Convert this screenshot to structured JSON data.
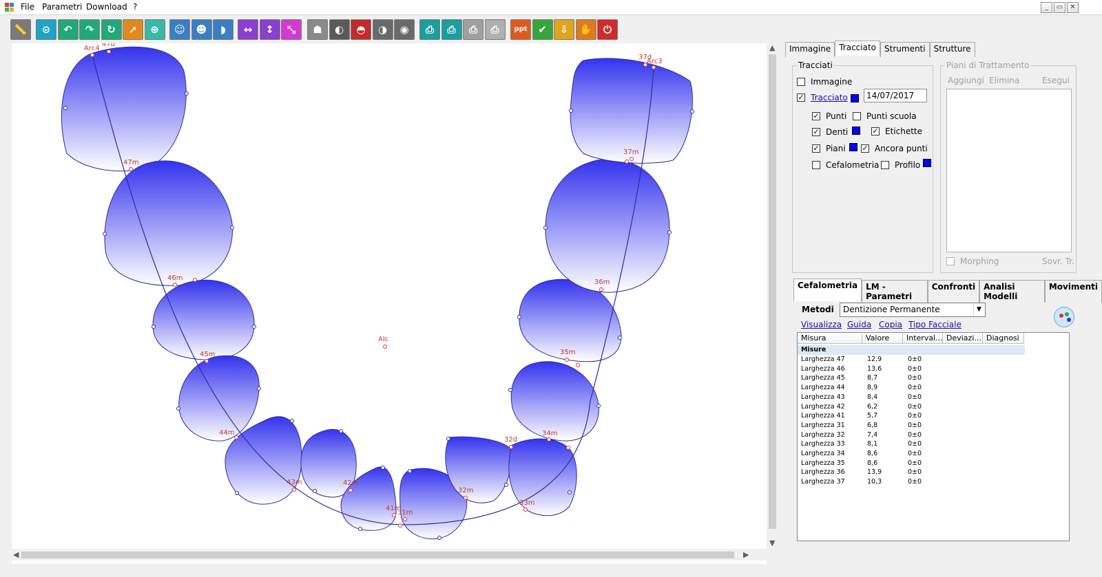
{
  "menu": {
    "items": [
      "File",
      "Parametri",
      "Download",
      "?"
    ]
  },
  "window_controls": [
    "_",
    "▭",
    "✕"
  ],
  "toolbar": {
    "buttons": [
      {
        "name": "ruler-tool-icon",
        "glyph": "📏",
        "color": "#7a7a7a"
      },
      {
        "name": "point-pin-icon",
        "glyph": "⊙",
        "color": "#1fa3c9"
      },
      {
        "name": "undo-arrow-icon",
        "glyph": "↶",
        "color": "#23a87a"
      },
      {
        "name": "redo-arrow-icon",
        "glyph": "↷",
        "color": "#23a87a"
      },
      {
        "name": "point-move-icon",
        "glyph": "↻",
        "color": "#23a87a"
      },
      {
        "name": "select-pointer-icon",
        "glyph": "➚",
        "color": "#e08a1e"
      },
      {
        "name": "point-target-icon",
        "glyph": "⊕",
        "color": "#36b9a7"
      },
      {
        "name": "portrait-icon",
        "glyph": "☺",
        "color": "#3a7fc4"
      },
      {
        "name": "portrait-search-icon",
        "glyph": "☻",
        "color": "#3a7fc4"
      },
      {
        "name": "profile-icon",
        "glyph": "◗",
        "color": "#3a7fc4"
      },
      {
        "name": "move-horizontal-icon",
        "glyph": "↔",
        "color": "#8a3fd1"
      },
      {
        "name": "move-vertical-icon",
        "glyph": "↕",
        "color": "#8a3fd1"
      },
      {
        "name": "diagonal-move-icon",
        "glyph": "⤡",
        "color": "#d43ad1"
      },
      {
        "name": "patient-photo-icon",
        "glyph": "☗",
        "color": "#8a8a8a"
      },
      {
        "name": "xray-lamp-icon",
        "glyph": "◐",
        "color": "#5a5a5a"
      },
      {
        "name": "smile-icon",
        "glyph": "◓",
        "color": "#c02c2c"
      },
      {
        "name": "face-profile-icon",
        "glyph": "◑",
        "color": "#6a6a6a"
      },
      {
        "name": "eye-icon",
        "glyph": "◉",
        "color": "#6a6a6a"
      },
      {
        "name": "print-icon",
        "glyph": "⎙",
        "color": "#1a9e9e"
      },
      {
        "name": "print-preview-icon",
        "glyph": "⎙",
        "color": "#1a9e9e"
      },
      {
        "name": "print-grey-icon",
        "glyph": "⎙",
        "color": "#a0a0a0"
      },
      {
        "name": "print-multi-icon",
        "glyph": "⎙",
        "color": "#b0b0b0"
      },
      {
        "name": "ppt-export-icon",
        "glyph": "ppt",
        "color": "#e05a1e"
      },
      {
        "name": "checkmark-icon",
        "glyph": "✔",
        "color": "#3aa53a"
      },
      {
        "name": "download-icon",
        "glyph": "⇩",
        "color": "#e0a51e"
      },
      {
        "name": "hand-icon",
        "glyph": "✋",
        "color": "#e07a1e"
      },
      {
        "name": "exit-icon",
        "glyph": "⏻",
        "color": "#d42a2a"
      }
    ]
  },
  "canvas": {
    "labels": {
      "arc4": "Arc4",
      "t47d": "47d",
      "t47m": "47m",
      "t46m": "46m",
      "t45m": "45m",
      "t44m": "44m",
      "t43m": "43m",
      "t42m": "42m",
      "t41m": "41m",
      "t31m": "31m",
      "t32m": "32m",
      "t32d": "32d",
      "t33m": "33m",
      "t34m": "34m",
      "t35m": "35m",
      "t36m": "36m",
      "t37m": "37m",
      "t37d": "37d",
      "arc3": "Arc3",
      "alc": "Alc"
    }
  },
  "right_panel": {
    "top_tabs": [
      "Immagine",
      "Tracciato",
      "Strumenti",
      "Strutture"
    ],
    "active_top_tab": "Tracciato",
    "tracciati": {
      "title": "Tracciati",
      "immagine": {
        "label": "Immagine",
        "checked": false
      },
      "tracciato": {
        "label": "Tracciato",
        "checked": true,
        "date": "14/07/2017"
      },
      "punti": {
        "label": "Punti",
        "checked": true
      },
      "punti_scuola": {
        "label": "Punti scuola",
        "checked": false
      },
      "denti": {
        "label": "Denti",
        "checked": true
      },
      "etichette": {
        "label": "Etichette",
        "checked": true
      },
      "piani": {
        "label": "Piani",
        "checked": true
      },
      "ancora_punti": {
        "label": "Ancora punti",
        "checked": true
      },
      "cefalometria": {
        "label": "Cefalometria",
        "checked": false
      },
      "profilo": {
        "label": "Profilo",
        "checked": false
      },
      "swatch_color": "#0000ff"
    },
    "piani_trattamento": {
      "title": "Piani di Trattamento",
      "aggiungi": "Aggiungi",
      "elimina": "Elimina",
      "esegui": "Esegui",
      "morphing": "Morphing",
      "sovr": "Sovr. Tr."
    },
    "bottom_tabs": [
      "Cefalometria",
      "LM - Parametri",
      "Confronti",
      "Analisi Modelli",
      "Movimenti"
    ],
    "active_bottom_tab": "Cefalometria",
    "metodi_label": "Metodi",
    "metodi_value": "Dentizione Permanente",
    "links": [
      "Visualizza",
      "Guida",
      "Copia",
      "Tipo Facciale"
    ],
    "grid": {
      "columns": [
        "Misura",
        "Valore",
        "Interval...",
        "Deviazi...",
        "Diagnosi"
      ],
      "group": "Misure",
      "rows": [
        [
          "Larghezza 47",
          "12,9",
          "0±0"
        ],
        [
          "Larghezza 46",
          "13,6",
          "0±0"
        ],
        [
          "Larghezza 45",
          "8,7",
          "0±0"
        ],
        [
          "Larghezza 44",
          "8,9",
          "0±0"
        ],
        [
          "Larghezza 43",
          "8,4",
          "0±0"
        ],
        [
          "Larghezza 42",
          "6,2",
          "0±0"
        ],
        [
          "Larghezza 41",
          "5,7",
          "0±0"
        ],
        [
          "Larghezza 31",
          "6,8",
          "0±0"
        ],
        [
          "Larghezza 32",
          "7,4",
          "0±0"
        ],
        [
          "Larghezza 33",
          "8,1",
          "0±0"
        ],
        [
          "Larghezza 34",
          "8,6",
          "0±0"
        ],
        [
          "Larghezza 35",
          "8,6",
          "0±0"
        ],
        [
          "Larghezza 36",
          "13,9",
          "0±0"
        ],
        [
          "Larghezza 37",
          "10,3",
          "0±0"
        ]
      ]
    }
  }
}
